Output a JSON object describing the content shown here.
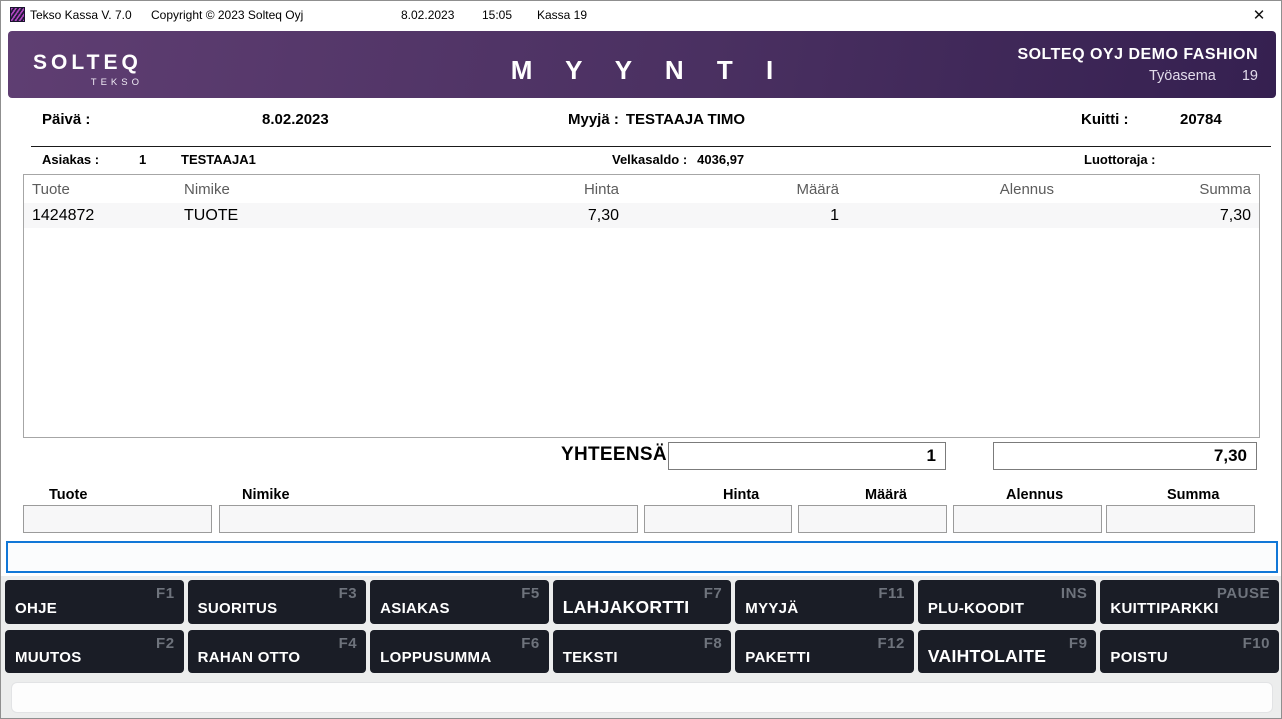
{
  "titlebar": {
    "app_title": "Tekso Kassa V. 7.0",
    "copyright": "Copyright © 2023 Solteq Oyj",
    "date": "8.02.2023",
    "time": "15:05",
    "register": "Kassa 19",
    "close_icon": "✕"
  },
  "header": {
    "logo_primary": "SOLTEQ",
    "logo_secondary": "TEKSO",
    "title": "M Y Y N T I",
    "store_name": "SOLTEQ OYJ DEMO FASHION",
    "workstation_label": "Työasema",
    "workstation_number": "19"
  },
  "info_row": {
    "date_label": "Päivä :",
    "date_value": "8.02.2023",
    "seller_label": "Myyjä :",
    "seller_value": "TESTAAJA TIMO",
    "receipt_label": "Kuitti :",
    "receipt_value": "20784"
  },
  "customer_row": {
    "customer_label": "Asiakas :",
    "customer_number": "1",
    "customer_name": "TESTAAJA1",
    "debt_label": "Velkasaldo :",
    "debt_value": "4036,97",
    "credit_label": "Luottoraja :",
    "credit_value": ""
  },
  "items_table": {
    "columns": [
      "Tuote",
      "Nimike",
      "Hinta",
      "Määrä",
      "Alennus",
      "Summa"
    ],
    "rows": [
      {
        "tuote": "1424872",
        "nimike": "TUOTE",
        "hinta": "7,30",
        "maara": "1",
        "alennus": "",
        "summa": "7,30"
      }
    ]
  },
  "totals": {
    "label": "YHTEENSÄ",
    "quantity": "1",
    "sum": "7,30"
  },
  "entry": {
    "labels": [
      "Tuote",
      "Nimike",
      "Hinta",
      "Määrä",
      "Alennus",
      "Summa"
    ],
    "values": [
      "",
      "",
      "",
      "",
      "",
      ""
    ],
    "command_value": ""
  },
  "function_buttons": {
    "row1": [
      {
        "label": "OHJE",
        "key": "F1"
      },
      {
        "label": "SUORITUS",
        "key": "F3"
      },
      {
        "label": "ASIAKAS",
        "key": "F5"
      },
      {
        "label": "LAHJAKORTTI",
        "key": "F7"
      },
      {
        "label": "MYYJÄ",
        "key": "F11"
      },
      {
        "label": "PLU-KOODIT",
        "key": "INS"
      },
      {
        "label": "KUITTIPARKKI",
        "key": "PAUSE"
      }
    ],
    "row2": [
      {
        "label": "MUUTOS",
        "key": "F2"
      },
      {
        "label": "RAHAN OTTO",
        "key": "F4"
      },
      {
        "label": "LOPPUSUMMA",
        "key": "F6"
      },
      {
        "label": "TEKSTI",
        "key": "F8"
      },
      {
        "label": "PAKETTI",
        "key": "F12"
      },
      {
        "label": "VAIHTOLAITE",
        "key": "F9"
      },
      {
        "label": "POISTU",
        "key": "F10"
      }
    ]
  },
  "colors": {
    "header_gradient_start": "#5f3e72",
    "header_gradient_end": "#352050",
    "button_bg": "#1a1d26",
    "button_key_text": "#6e737c",
    "focus_border_blue": "#1177d7",
    "table_header_text": "#5c5c5c",
    "row_alt_bg": "#f7f7f8"
  }
}
